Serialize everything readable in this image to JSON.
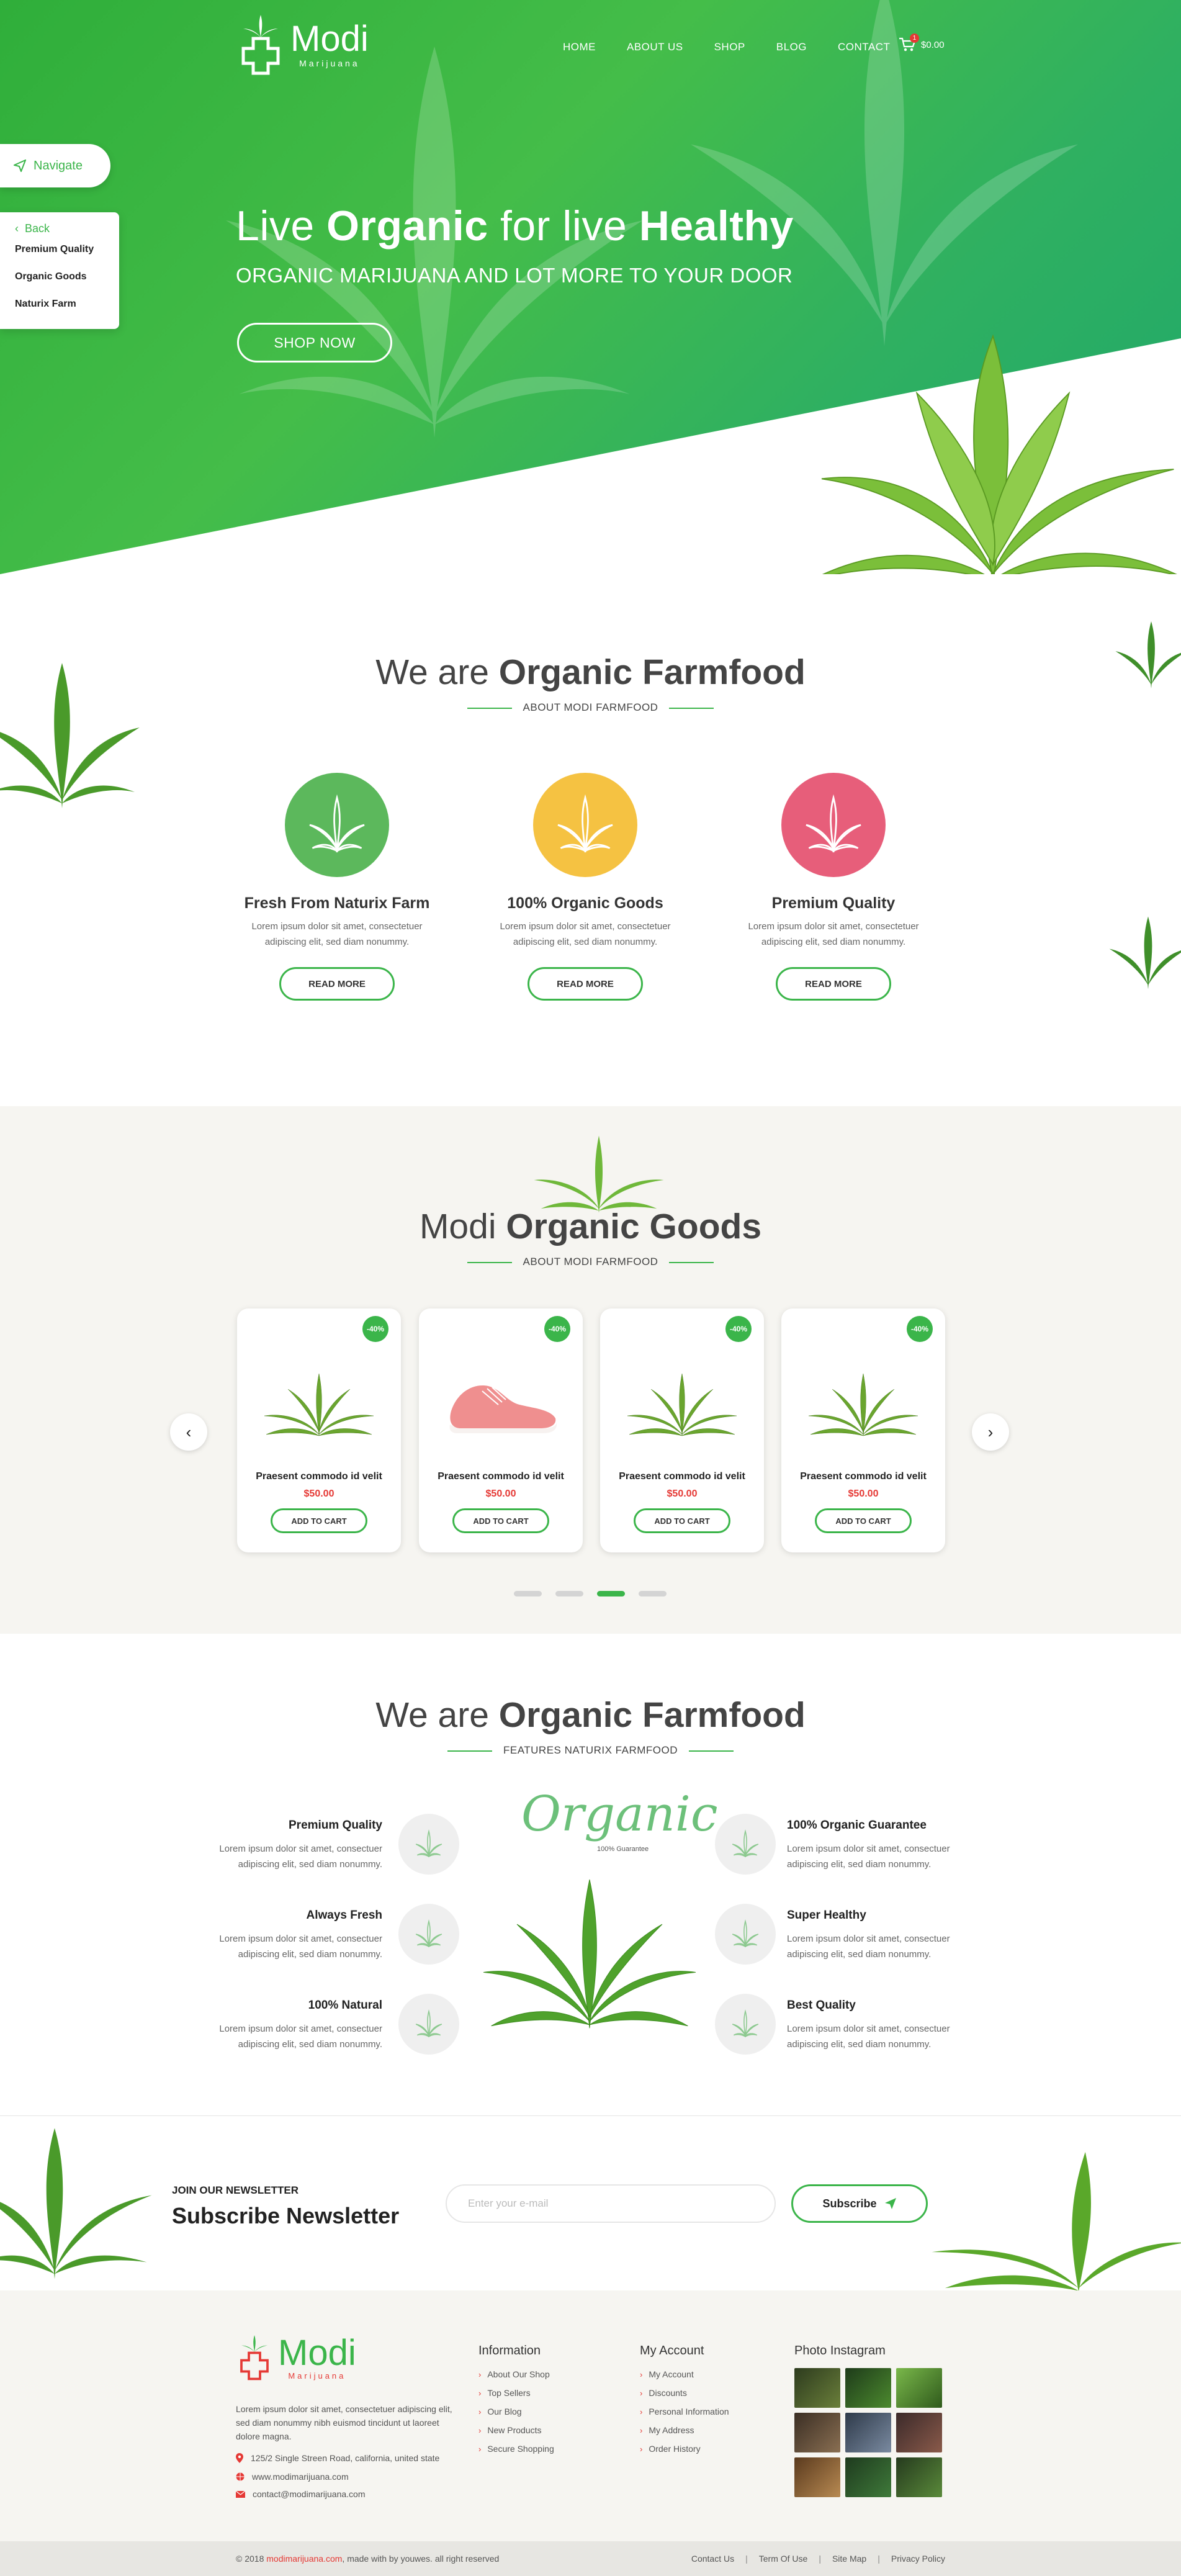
{
  "header": {
    "logo_word": "Modi",
    "logo_sub": "Marijuana",
    "nav": [
      "HOME",
      "ABOUT US",
      "SHOP",
      "BLOG",
      "CONTACT"
    ],
    "cart_count": "1",
    "cart_total": "$0.00"
  },
  "hero": {
    "title_pre": "Live ",
    "title_bold1": "Organic",
    "title_mid": " for live ",
    "title_bold2": "Healthy",
    "subtitle": "ORGANIC MARIJUANA AND LOT MORE TO YOUR DOOR",
    "cta": "SHOP NOW"
  },
  "sidenav": {
    "navigate": "Navigate",
    "back": "Back",
    "items": [
      "Premium Quality",
      "Organic Goods",
      "Naturix Farm"
    ]
  },
  "about": {
    "title_light": "We are ",
    "title_bold": "Organic Farmfood",
    "subtitle": "ABOUT MODI FARMFOOD",
    "features": [
      {
        "title": "Fresh From Naturix Farm",
        "text": "Lorem ipsum dolor sit amet, consectetuer adipiscing elit, sed diam nonummy.",
        "button": "READ MORE",
        "color": "#5cb85c"
      },
      {
        "title": "100% Organic Goods",
        "text": "Lorem ipsum dolor sit amet, consectetuer adipiscing elit, sed diam nonummy.",
        "button": "READ MORE",
        "color": "#f5c242"
      },
      {
        "title": "Premium Quality",
        "text": "Lorem ipsum dolor sit amet, consectetuer adipiscing elit, sed diam nonummy.",
        "button": "READ MORE",
        "color": "#e75e7a"
      }
    ]
  },
  "goods": {
    "title_light": "Modi ",
    "title_bold": "Organic Goods",
    "subtitle": "ABOUT MODI FARMFOOD",
    "products": [
      {
        "discount": "-40%",
        "name": "Praesent commodo id velit",
        "price": "$50.00",
        "button": "ADD TO CART",
        "image": "plant"
      },
      {
        "discount": "-40%",
        "name": "Praesent commodo id velit",
        "price": "$50.00",
        "button": "ADD TO CART",
        "image": "sneaker"
      },
      {
        "discount": "-40%",
        "name": "Praesent commodo id velit",
        "price": "$50.00",
        "button": "ADD TO CART",
        "image": "plant"
      },
      {
        "discount": "-40%",
        "name": "Praesent commodo id velit",
        "price": "$50.00",
        "button": "ADD TO CART",
        "image": "plant"
      }
    ],
    "active_page": 3,
    "page_count": 4
  },
  "features": {
    "title_light": "We are ",
    "title_bold": "Organic Farmfood",
    "subtitle": "FEATURES NATURIX FARMFOOD",
    "organic_word": "Organic",
    "organic_guarantee": "100% Guarantee",
    "left": [
      {
        "title": "Premium Quality",
        "text": "Lorem ipsum dolor sit amet, consectuer adipiscing elit, sed diam nonummy."
      },
      {
        "title": "Always Fresh",
        "text": "Lorem ipsum dolor sit amet, consectuer adipiscing elit, sed diam nonummy."
      },
      {
        "title": "100% Natural",
        "text": "Lorem ipsum dolor sit amet, consectuer adipiscing elit, sed diam nonummy."
      }
    ],
    "right": [
      {
        "title": "100% Organic Guarantee",
        "text": "Lorem ipsum dolor sit amet, consectuer adipiscing elit, sed diam nonummy."
      },
      {
        "title": "Super Healthy",
        "text": "Lorem ipsum dolor sit amet, consectuer adipiscing elit, sed diam nonummy."
      },
      {
        "title": "Best Quality",
        "text": "Lorem ipsum dolor sit amet, consectuer adipiscing elit, sed diam nonummy."
      }
    ]
  },
  "newsletter": {
    "small": "JOIN OUR NEWSLETTER",
    "title": "Subscribe Newsletter",
    "placeholder": "Enter your e-mail",
    "button": "Subscribe"
  },
  "footer": {
    "logo_word": "Modi",
    "logo_sub": "Marijuana",
    "description": "Lorem ipsum dolor sit amet, consectetuer adipiscing elit, sed diam nonummy nibh euismod tincidunt ut laoreet dolore magna.",
    "address": "125/2 Single Streen Road, california, united state",
    "website": "www.modimarijuana.com",
    "email": "contact@modimarijuana.com",
    "information_title": "Information",
    "information": [
      "About Our Shop",
      "Top Sellers",
      "Our Blog",
      "New Products",
      "Secure Shopping"
    ],
    "account_title": "My Account",
    "account": [
      "My Account",
      "Discounts",
      "Personal Information",
      "My Address",
      "Order History"
    ],
    "instagram_title": "Photo Instagram",
    "copyright_pre": "© 2018 ",
    "copyright_brand": "modimarijuana.com",
    "copyright_post": ", made with  by youwes. all right reserved",
    "links": [
      "Contact Us",
      "Term Of Use",
      "Site Map",
      "Privacy Policy"
    ]
  },
  "colors": {
    "brand_green": "#3bb54a",
    "accent_red": "#e53935"
  }
}
